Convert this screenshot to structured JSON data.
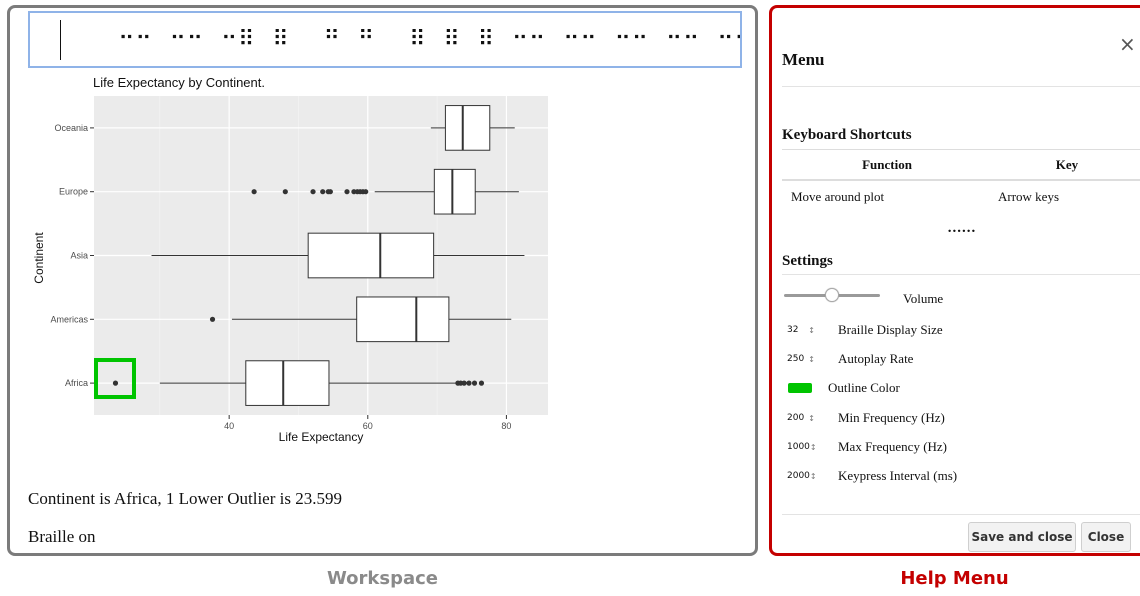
{
  "workspace": {
    "caption": "Workspace",
    "braille_display": "⠀⠀⠀⠒⠒⠀⠒⠒⠀⠒⠿⠀⠿⠀⠀⠛⠀⠛⠀⠀⠿⠀⠿⠀⠿⠀⠒⠒⠀⠒⠒⠀⠒⠒⠀⠒⠒⠀⠒⠒⠀⠀⠀⠀⠒⠀⠒⠀⠒⠀⠒⠀⠒⠀⠒⠀⠒⠀⠒⠀⠒",
    "status_line_1": "Continent is Africa, 1 Lower Outlier is 23.599",
    "status_line_2": "Braille on",
    "highlight_color": "#00c400"
  },
  "chart_data": {
    "type": "boxplot",
    "title": "Life Expectancy by Continent.",
    "xlabel": "Life Expectancy",
    "ylabel": "Continent",
    "xlim": [
      20.5,
      86
    ],
    "x_ticks": [
      40,
      60,
      80
    ],
    "categories": [
      "Oceania",
      "Europe",
      "Asia",
      "Americas",
      "Africa"
    ],
    "boxes": [
      {
        "name": "Oceania",
        "whisker_low": 69.1,
        "q1": 71.2,
        "median": 73.7,
        "q3": 77.6,
        "whisker_high": 81.2,
        "outliers": []
      },
      {
        "name": "Europe",
        "whisker_low": 61.0,
        "q1": 69.6,
        "median": 72.2,
        "q3": 75.5,
        "whisker_high": 81.8,
        "outliers": [
          43.6,
          48.1,
          52.1,
          53.5,
          54.3,
          54.6,
          57.0,
          58.0,
          58.5,
          58.9,
          59.3,
          59.7
        ]
      },
      {
        "name": "Asia",
        "whisker_low": 28.8,
        "q1": 51.4,
        "median": 61.8,
        "q3": 69.5,
        "whisker_high": 82.6,
        "outliers": []
      },
      {
        "name": "Americas",
        "whisker_low": 40.4,
        "q1": 58.4,
        "median": 67.0,
        "q3": 71.7,
        "whisker_high": 80.7,
        "outliers": [
          37.6
        ]
      },
      {
        "name": "Africa",
        "whisker_low": 30.0,
        "q1": 42.4,
        "median": 47.8,
        "q3": 54.4,
        "whisker_high": 72.8,
        "outliers": [
          23.599,
          73.0,
          73.4,
          73.9,
          74.6,
          75.4,
          76.4
        ]
      }
    ],
    "selected": {
      "category": "Africa",
      "value": 23.599
    },
    "grid": true,
    "legend": "none"
  },
  "help": {
    "caption": "Help Menu",
    "title": "Menu",
    "close_icon": "×",
    "shortcuts_heading": "Keyboard Shortcuts",
    "shortcuts_columns": [
      "Function",
      "Key"
    ],
    "shortcuts_rows": [
      {
        "function": "Move around plot",
        "key": "Arrow keys"
      }
    ],
    "shortcuts_more": "......",
    "settings_heading": "Settings",
    "volume_label": "Volume",
    "volume_value": 0.5,
    "braille_size_value": "32",
    "braille_size_label": "Braille Display Size",
    "autoplay_value": "250",
    "autoplay_label": "Autoplay Rate",
    "outline_color": "#00c400",
    "outline_color_label": "Outline Color",
    "min_freq_value": "200",
    "min_freq_label": "Min Frequency (Hz)",
    "max_freq_value": "1000",
    "max_freq_label": "Max Frequency (Hz)",
    "keypress_value": "2000",
    "keypress_label": "Keypress Interval (ms)",
    "spin_glyph": "↕",
    "save_button": "Save and close",
    "close_button": "Close",
    "accent_color": "#c40000"
  }
}
